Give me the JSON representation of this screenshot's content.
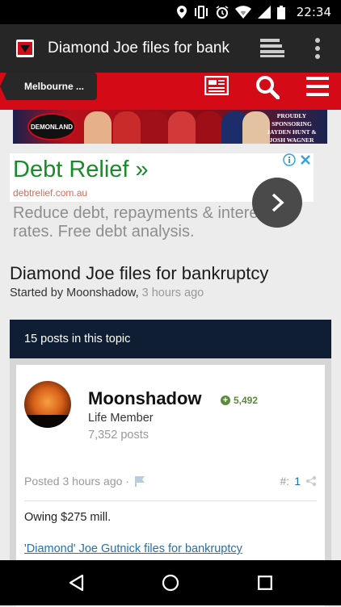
{
  "status_bar": {
    "time": "22:34",
    "icons": [
      "location-icon",
      "vibrate-icon",
      "alarm-icon",
      "wifi-icon",
      "signal-icon",
      "battery-icon"
    ]
  },
  "browser": {
    "tab_title": "Diamond Joe files for bank",
    "icons": [
      "site-favicon",
      "bookmarks-icon",
      "overflow-menu-icon"
    ]
  },
  "site_header": {
    "breadcrumb": "Melbourne ...",
    "icons": [
      "news-icon",
      "search-icon",
      "hamburger-menu-icon"
    ],
    "accent_color": "#d40b17"
  },
  "banner": {
    "club_badge": "DEMONLAND",
    "promo_line1": "PROUDLY SPONSORING",
    "promo_line2": "JAYDEN HUNT &",
    "promo_line3": "JOSH WAGNER"
  },
  "ad": {
    "title": "Debt Relief »",
    "url": "debtrelief.com.au",
    "body": "Reduce debt, repayments & interest rates. Free debt analysis.",
    "title_color": "#1a8b2a"
  },
  "topic": {
    "title": "Diamond Joe files for bankruptcy",
    "started_by_prefix": "Started by ",
    "author": "Moonshadow,",
    "time": " 3 hours ago",
    "posts_count_label": "15 posts in this topic"
  },
  "post": {
    "author": "Moonshadow",
    "reputation": "5,492",
    "member_title": "Life Member",
    "post_count": "7,352 posts",
    "posted": "Posted 3 hours ago ·",
    "number_prefix": "#:",
    "number": "1",
    "text": "Owing $275 mill.",
    "link_text": "'Diamond' Joe Gutnick files for bankruptcy"
  },
  "nav": {
    "icons": [
      "back-icon",
      "home-icon",
      "recents-icon"
    ]
  }
}
